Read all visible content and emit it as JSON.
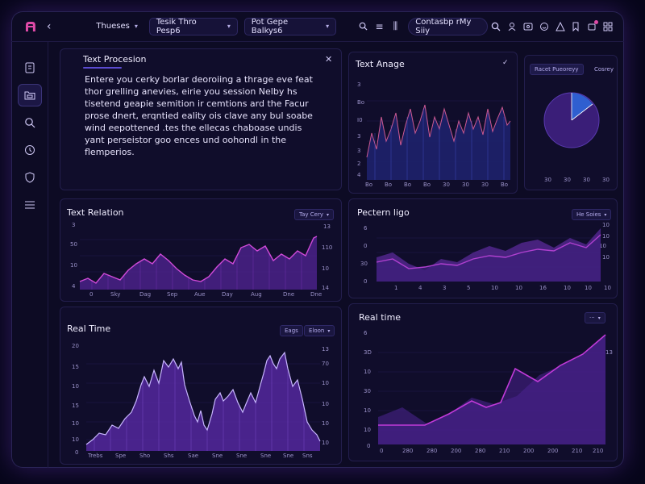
{
  "header": {
    "menu1": "Thueses",
    "menu2": "Tesik Thro Pesp6",
    "menu3": "Pot Gepe Balkys6",
    "search_box": "Contasbp rMy Siiy"
  },
  "text_panel": {
    "title": "Text Procesion",
    "lines": [
      "Entere you cerky borlar deoroiing a thrage eve feat",
      "thor grelling anevies, eirie you session Nelby hs",
      "tisetend geapie semition ir cemtions ard the Facur",
      "prose dnert, erqntied eality ois clave any bul soabe",
      "wind eepottened .tes the ellecas chaboase undis",
      "yant perseistor goo ences und oohondl in the",
      "flemperios."
    ]
  },
  "text_anage": {
    "title": "Text Anage",
    "y_top": "3",
    "y_labels": [
      "3",
      "Bo",
      "I0",
      "3",
      "3",
      "2",
      "4"
    ],
    "x_labels": [
      "Bo",
      "Bo",
      "Bo",
      "Bo",
      "30",
      "30",
      "30",
      "Bo"
    ]
  },
  "pie_panel": {
    "tab1": "Racet Pueoreyy",
    "tab2": "Cosrey",
    "x_labels": [
      "30",
      "30",
      "30",
      "30"
    ],
    "slice_color": "#2f5fd0",
    "body_color": "#3a1e78"
  },
  "text_relation": {
    "title": "Text Relation",
    "chip": "Tay Cery",
    "y_labels": [
      "3",
      "50",
      "10",
      "4"
    ],
    "y_right": [
      "13",
      "110",
      "10",
      "14"
    ],
    "x_labels": [
      "0",
      "Sky",
      "Dag",
      "Sep",
      "Aue",
      "Day",
      "Aug",
      "Dne",
      "Dne"
    ]
  },
  "pectern_ligo": {
    "title": "Pectern ligo",
    "chip": "He Soies",
    "y_labels": [
      "6",
      "0",
      "30",
      "0"
    ],
    "y_right": [
      "10",
      "10",
      "10",
      "10"
    ],
    "x_labels": [
      "1",
      "4",
      "3",
      "5",
      "10",
      "10",
      "16",
      "10",
      "10",
      "10"
    ],
    "colors": {
      "line": "#b040d0",
      "area": "#5a2a9a"
    }
  },
  "real_time_left": {
    "title": "Real Time",
    "chip1": "Eags",
    "chip2": "Eloon",
    "y_labels": [
      "20",
      "15",
      "10",
      "15",
      "10",
      "10",
      "0"
    ],
    "y_right": [
      "13",
      "70",
      "10",
      "10",
      "10",
      "10"
    ],
    "x_labels": [
      "Trebs",
      "Spe",
      "Sho",
      "Shs",
      "Sae",
      "Sne",
      "Sne",
      "Sne",
      "Sne",
      "Sns"
    ],
    "colors": {
      "line": "#c8b6ff",
      "fill": "#5a2aa8"
    }
  },
  "real_time_right": {
    "title": "Real time",
    "y_labels": [
      "6",
      "3D",
      "10",
      "30",
      "10",
      "10",
      "0"
    ],
    "y_right": [
      "13"
    ],
    "x_labels": [
      "0",
      "280",
      "280",
      "200",
      "280",
      "210",
      "200",
      "200",
      "210",
      "210"
    ],
    "colors": {
      "line": "#c03ad8",
      "area": "#3d1f7a"
    }
  },
  "colors": {
    "accent": "#e04aa8",
    "background": "#0d0b24",
    "panel": "#100d2b"
  }
}
